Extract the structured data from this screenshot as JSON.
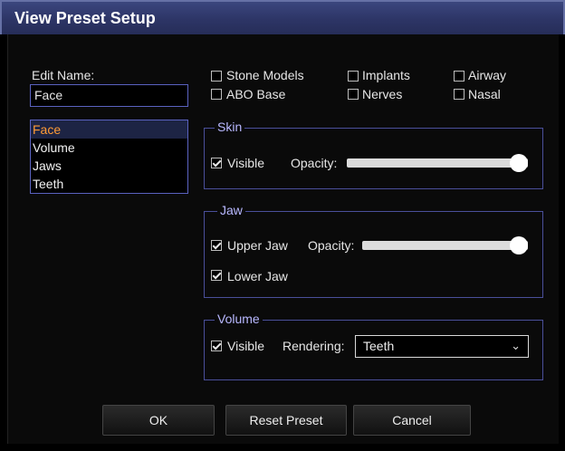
{
  "window": {
    "title": "View Preset Setup"
  },
  "edit_name": {
    "label": "Edit Name:",
    "value": "Face"
  },
  "presets": {
    "items": [
      "Face",
      "Volume",
      "Jaws",
      "Teeth"
    ],
    "selected": "Face"
  },
  "toggles": {
    "stone_models": "Stone Models",
    "abo_base": "ABO Base",
    "implants": "Implants",
    "nerves": "Nerves",
    "airway": "Airway",
    "nasal": "Nasal"
  },
  "skin": {
    "title": "Skin",
    "visible_label": "Visible",
    "opacity_label": "Opacity:",
    "opacity": 1.0
  },
  "jaw": {
    "title": "Jaw",
    "upper_label": "Upper Jaw",
    "opacity_label": "Opacity:",
    "opacity": 1.0,
    "lower_label": "Lower Jaw"
  },
  "volume": {
    "title": "Volume",
    "visible_label": "Visible",
    "rendering_label": "Rendering:",
    "rendering_value": "Teeth"
  },
  "buttons": {
    "ok": "OK",
    "reset": "Reset Preset",
    "cancel": "Cancel"
  },
  "colors": {
    "accent_border": "#5a62c0",
    "selected_text": "#ff9b36",
    "group_title": "#b8b8ff"
  }
}
